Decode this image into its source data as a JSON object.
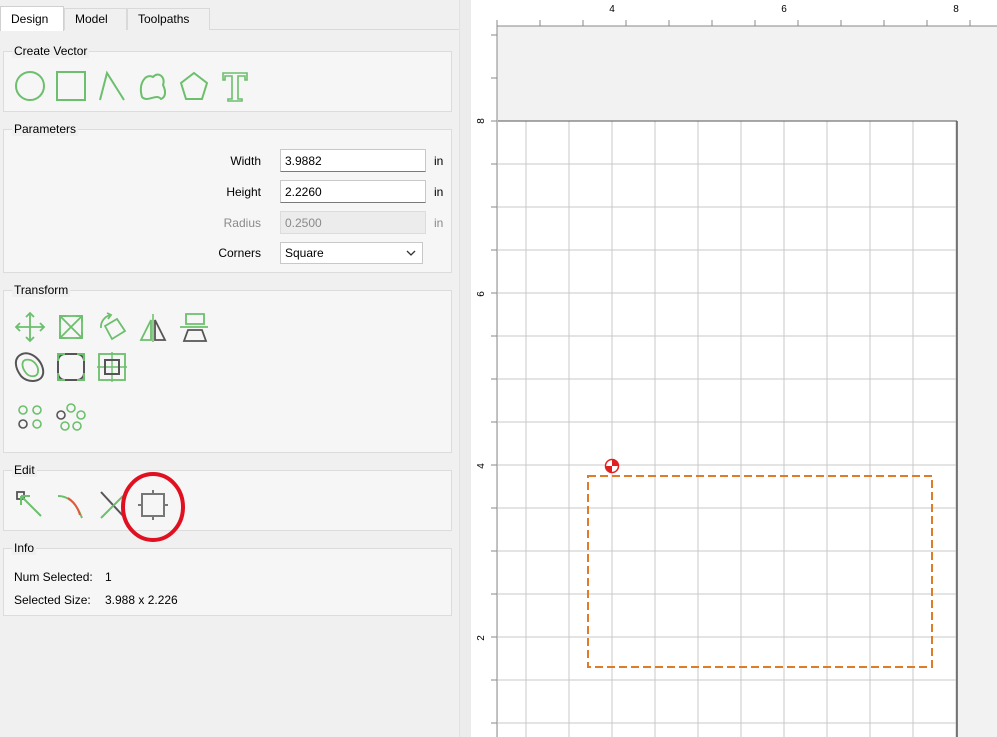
{
  "tabs": [
    {
      "label": "Design",
      "active": true
    },
    {
      "label": "Model",
      "active": false
    },
    {
      "label": "Toolpaths",
      "active": false
    }
  ],
  "create_vector": {
    "title": "Create Vector",
    "tools": [
      "circle-icon",
      "rectangle-icon",
      "polyline-icon",
      "curve-icon",
      "polygon-icon",
      "text-icon"
    ]
  },
  "parameters": {
    "title": "Parameters",
    "width": {
      "label": "Width",
      "value": "3.9882",
      "unit": "in"
    },
    "height": {
      "label": "Height",
      "value": "2.2260",
      "unit": "in"
    },
    "radius": {
      "label": "Radius",
      "value": "0.2500",
      "unit": "in",
      "disabled": true
    },
    "corners": {
      "label": "Corners",
      "value": "Square"
    }
  },
  "transform": {
    "title": "Transform",
    "tools": [
      "move-icon",
      "scale-icon",
      "rotate-icon",
      "mirror-icon",
      "align-icon",
      "offset-icon",
      "fillet-icon",
      "bounding-box-icon",
      "array-icon",
      "circular-array-icon"
    ]
  },
  "edit": {
    "title": "Edit",
    "tools": [
      "node-edit-icon",
      "smooth-icon",
      "trim-icon",
      "bounding-box-edit-icon"
    ],
    "highlighted_tool": "bounding-box-edit-icon"
  },
  "info": {
    "title": "Info",
    "num_selected_label": "Num Selected:",
    "num_selected_value": "1",
    "selected_size_label": "Selected Size:",
    "selected_size_value": "3.988 x 2.226"
  },
  "canvas": {
    "ruler_top_labels": [
      "4",
      "6",
      "8"
    ],
    "ruler_left_labels": [
      "8",
      "6",
      "4",
      "2"
    ],
    "selection_color": "#e07b2a",
    "grid_color": "#c8c8c8",
    "origin_marker_color": "#e02020",
    "highlight_color": "#e01020",
    "tool_color": "#6cbf6c"
  }
}
